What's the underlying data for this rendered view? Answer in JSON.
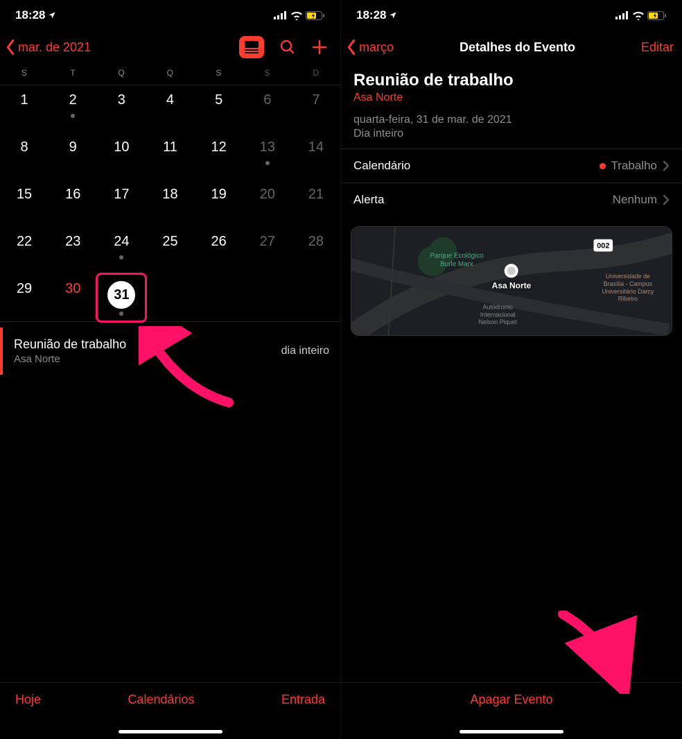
{
  "status": {
    "time": "18:28"
  },
  "left": {
    "back_label": "mar. de 2021",
    "weekdays": [
      "S",
      "T",
      "Q",
      "Q",
      "S",
      "S",
      "D"
    ],
    "weeks": [
      [
        {
          "n": "1"
        },
        {
          "n": "2",
          "dot": true
        },
        {
          "n": "3"
        },
        {
          "n": "4"
        },
        {
          "n": "5"
        },
        {
          "n": "6",
          "wknd": true
        },
        {
          "n": "7",
          "wknd": true
        }
      ],
      [
        {
          "n": "8"
        },
        {
          "n": "9"
        },
        {
          "n": "10"
        },
        {
          "n": "11"
        },
        {
          "n": "12"
        },
        {
          "n": "13",
          "wknd": true,
          "dot": true
        },
        {
          "n": "14",
          "wknd": true
        }
      ],
      [
        {
          "n": "15"
        },
        {
          "n": "16"
        },
        {
          "n": "17"
        },
        {
          "n": "18"
        },
        {
          "n": "19"
        },
        {
          "n": "20",
          "wknd": true
        },
        {
          "n": "21",
          "wknd": true
        }
      ],
      [
        {
          "n": "22"
        },
        {
          "n": "23"
        },
        {
          "n": "24",
          "dot": true
        },
        {
          "n": "25"
        },
        {
          "n": "26"
        },
        {
          "n": "27",
          "wknd": true
        },
        {
          "n": "28",
          "wknd": true
        }
      ],
      [
        {
          "n": "29"
        },
        {
          "n": "30",
          "red": true
        },
        {
          "n": "31",
          "selected": true,
          "dot": true,
          "hl": true
        },
        {
          "n": ""
        },
        {
          "n": ""
        },
        {
          "n": ""
        },
        {
          "n": ""
        }
      ]
    ],
    "event": {
      "title": "Reunião de trabalho",
      "location": "Asa Norte",
      "when": "dia inteiro"
    },
    "toolbar": {
      "today": "Hoje",
      "calendars": "Calendários",
      "inbox": "Entrada"
    }
  },
  "right": {
    "back_label": "março",
    "title": "Detalhes do Evento",
    "edit": "Editar",
    "event": {
      "title": "Reunião de trabalho",
      "location": "Asa Norte",
      "date": "quarta-feira, 31 de mar. de 2021",
      "allday": "Dia inteiro"
    },
    "rows": {
      "calendar_label": "Calendário",
      "calendar_value": "Trabalho",
      "alert_label": "Alerta",
      "alert_value": "Nenhum"
    },
    "map": {
      "pin_label": "Asa Norte",
      "poi1": "Parque Ecológico Burle Marx",
      "poi2": "Autódromo Internacional Nelson Piquet",
      "poi3": "Universidade de Brasília - Campus Universitário Darcy Ribeiro",
      "route": "002"
    },
    "delete": "Apagar Evento"
  }
}
